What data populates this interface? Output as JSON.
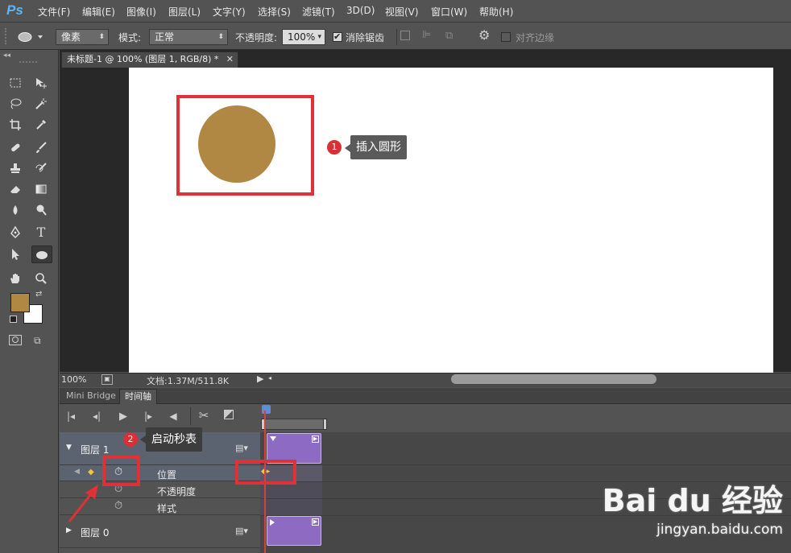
{
  "app": {
    "logo": "Ps"
  },
  "menu": [
    "文件(F)",
    "编辑(E)",
    "图像(I)",
    "图层(L)",
    "文字(Y)",
    "选择(S)",
    "滤镜(T)",
    "3D(D)",
    "视图(V)",
    "窗口(W)",
    "帮助(H)"
  ],
  "options": {
    "unit_value": "像素",
    "mode_label": "模式:",
    "mode_value": "正常",
    "opacity_label": "不透明度:",
    "opacity_value": "100%",
    "antialias_label": "消除锯齿",
    "align_edges_label": "对齐边缘"
  },
  "document": {
    "tab_title": "未标题-1 @ 100% (图层 1, RGB/8) *",
    "zoom": "100%",
    "doc_info": "文档:1.37M/511.8K",
    "circle_color": "#b08843",
    "canvas_color": "#ffffff"
  },
  "swatches": {
    "foreground": "#b08843",
    "background": "#ffffff"
  },
  "annotations": {
    "step1_num": "1",
    "step1_label": "插入圆形",
    "step2_num": "2",
    "step2_label": "启动秒表",
    "box_color": "#e03138"
  },
  "panel_tabs": [
    "Mini Bridge",
    "时间轴"
  ],
  "timeline": {
    "layers": [
      {
        "name": "图层 1",
        "expanded": true,
        "properties": [
          "位置",
          "不透明度",
          "样式"
        ]
      },
      {
        "name": "图层 0",
        "expanded": false
      }
    ],
    "clip_color": "#8e6bc2"
  },
  "watermark": {
    "logo": "Bai du 经验",
    "url": "jingyan.baidu.com"
  }
}
